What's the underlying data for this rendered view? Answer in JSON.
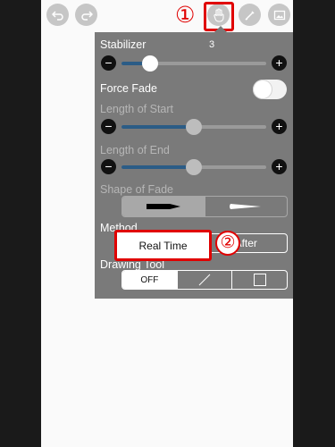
{
  "toolbar": {
    "undo_icon": "undo-icon",
    "redo_icon": "redo-icon",
    "hand_icon": "hand-icon",
    "pencil_icon": "pencil-icon",
    "image_icon": "image-icon"
  },
  "annotations": {
    "marker1": "①",
    "marker2": "②",
    "color": "#e00000"
  },
  "panel": {
    "stabilizer": {
      "label": "Stabilizer",
      "value": "3",
      "level": 0.2
    },
    "force_fade": {
      "label": "Force Fade",
      "on": false
    },
    "length_of_start": {
      "label": "Length of Start",
      "level": 0.5
    },
    "length_of_end": {
      "label": "Length of End",
      "level": 0.5
    },
    "shape_of_fade": {
      "label": "Shape of Fade",
      "selected": 0
    },
    "method": {
      "label": "Method",
      "options": [
        "Real Time",
        "After"
      ],
      "selected": 0
    },
    "drawing_tool": {
      "label": "Drawing Tool",
      "options": [
        "OFF",
        "line",
        "rectangle"
      ],
      "selected": 0
    }
  },
  "colors": {
    "panel_bg": "#7a7a7a",
    "slider_fill": "#2b5c86",
    "canvas": "#fafafa"
  }
}
